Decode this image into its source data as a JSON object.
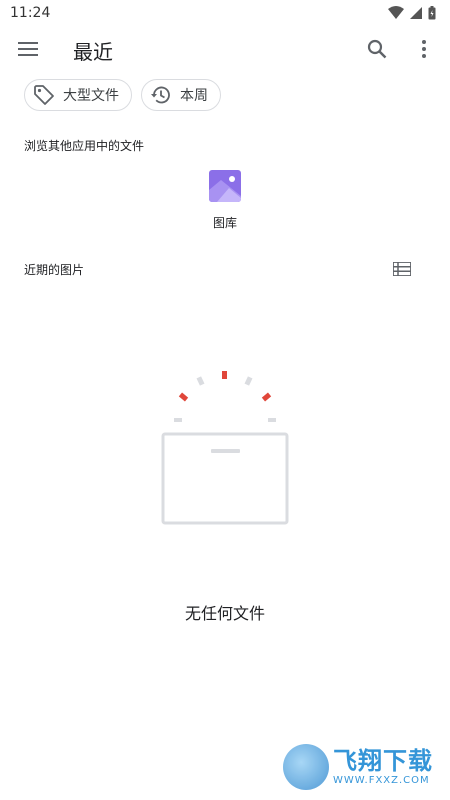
{
  "status": {
    "time": "11:24"
  },
  "app_bar": {
    "title": "最近"
  },
  "chips": [
    {
      "label": "大型文件",
      "icon": "tag-icon"
    },
    {
      "label": "本周",
      "icon": "history-icon"
    }
  ],
  "browse": {
    "label": "浏览其他应用中的文件",
    "apps": [
      {
        "label": "图库",
        "icon": "gallery-icon",
        "color": "#8b6fe8"
      }
    ]
  },
  "recent": {
    "label": "近期的图片"
  },
  "empty": {
    "message": "无任何文件"
  },
  "watermark": {
    "main": "飞翔下载",
    "sub": "WWW.FXXZ.COM"
  },
  "colors": {
    "accent_red": "#e0463a",
    "illustration_gray": "#dadce0"
  }
}
